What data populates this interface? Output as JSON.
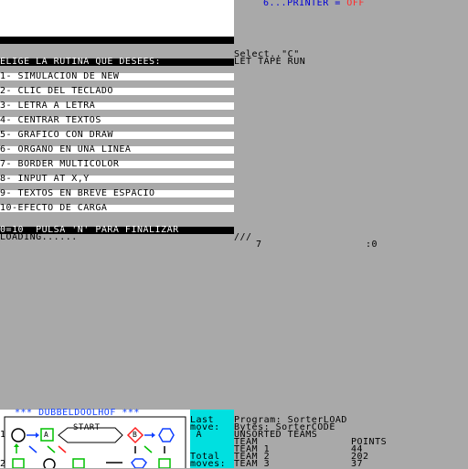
{
  "colors": {
    "blue": "#0000d7",
    "red": "#ff2a2a",
    "cyan": "#00e0e0",
    "grey": "#a9a9a9"
  },
  "printer": {
    "label": "6...PRINTER = ",
    "state": "OFF"
  },
  "menu": {
    "header": "ELIGE LA RUTINA QUE DESEES:",
    "items": [
      "1- SIMULACION DE NEW",
      "2- CLIC DEL TECLADO",
      "3- LETRA A LETRA",
      "4- CENTRAR TEXTOS",
      "5- GRAFICO CON DRAW",
      "6- ORGANO EN UNA LINEA",
      "7- BORDER MULTICOLOR",
      "8- INPUT AT X,Y",
      "9- TEXTOS EN BREVE ESPACIO",
      "10-EFECTO DE CARGA"
    ],
    "footer": "0=10  PULSA 'N' PARA FINALIZAR"
  },
  "loading": "LOADING......",
  "right_top": {
    "select": "Select..\"C\"",
    "tape": "LET TAPE RUN",
    "slashes": "///",
    "seven": "7",
    "zero": ":0"
  },
  "game_panel": {
    "title": "*** DUBBELDOOLHOF ***",
    "start": "START",
    "box_a": "A",
    "box_b": "B",
    "row1": "1",
    "row2": "2"
  },
  "cyan_panel": {
    "line1": "Last",
    "line2": "move:",
    "line3": " A",
    "line4": "Total",
    "line5": "moves:"
  },
  "console": {
    "program": "Program: SorterLOAD",
    "bytes": "Bytes: SorterCODE",
    "unsorted": "UNSORTED TEAMS",
    "team_header": "TEAM",
    "points_header": "POINTS",
    "rows": [
      {
        "team": "TEAM 1",
        "points": "44"
      },
      {
        "team": "TEAM 2",
        "points": "202"
      },
      {
        "team": "TEAM 3",
        "points": "37"
      }
    ]
  }
}
